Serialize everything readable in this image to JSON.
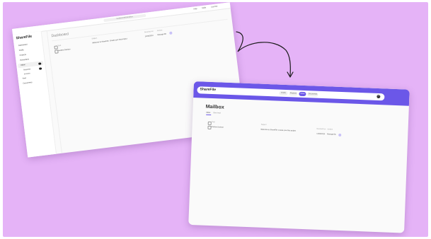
{
  "old_window": {
    "url": "localhost:3000/mailbox",
    "top_links": [
      "Help",
      "Mails",
      "Log Out"
    ],
    "brand": "ShareFile",
    "sidebar_items": [
      "Dashboard",
      "Drafts",
      "Projects",
      "Reminders",
      "Inbox",
      "Requests",
      "Invoices",
      "Sent",
      "Documents"
    ],
    "page_title": "Dashboard",
    "col_subject": "Subject",
    "col_received": "Received on",
    "col_actions": "Actions",
    "select_all": "Total",
    "row": {
      "name": "Andrew Davison",
      "subject": "Welcome to ShareFile: Create your first project",
      "date": "12/06/2024",
      "action": "Manage file"
    }
  },
  "new_window": {
    "brand": "ShareFile",
    "nav": [
      "Drafts",
      "Projects",
      "Inbox",
      "Documents"
    ],
    "active_nav_index": 2,
    "page_title": "Mailbox",
    "tabs": [
      "Inbox",
      "Sent mail"
    ],
    "col_subject": "Subject",
    "col_received": "Received on",
    "col_actions": "Actions",
    "select_all": "Total",
    "row": {
      "name": "Andrew Davison",
      "subject": "Welcome to ShareFile: Create your first project",
      "date": "12/06/2024",
      "action": "Manage file"
    },
    "avatar_initials": "AD"
  },
  "colors": {
    "background": "#e5b3f7",
    "accent": "#6b57e8",
    "arrow": "#1a1a1a"
  }
}
